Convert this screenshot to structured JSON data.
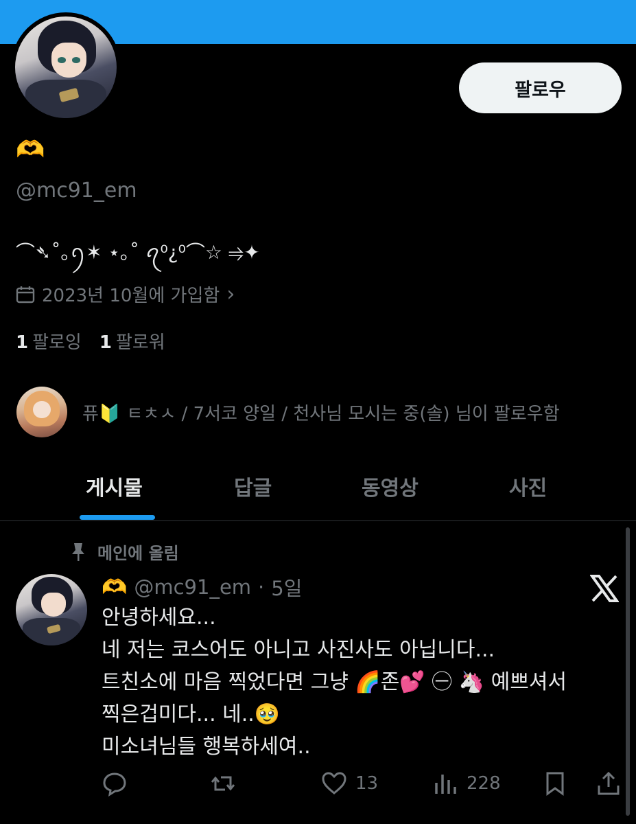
{
  "profile": {
    "display_name": "🫶",
    "handle": "@mc91_em",
    "bio": "⌒➴˚｡ꪆ✶ ⋆｡˚ ꪖ⁰¿⁰⌒☆ ⥤✦",
    "joined": "2023년 10월에 가입함",
    "joined_chevron": "›",
    "following_count": "1",
    "following_label": "팔로잉",
    "followers_count": "1",
    "followers_label": "팔로워",
    "follow_button": "팔로우",
    "followed_by": "퓨🔰 ㅌㅊㅅ / 7서코 양일 / 천사님 모시는 중(솔) 님이 팔로우함"
  },
  "tabs": [
    {
      "label": "게시물",
      "active": true
    },
    {
      "label": "답글",
      "active": false
    },
    {
      "label": "동영상",
      "active": false
    },
    {
      "label": "사진",
      "active": false
    }
  ],
  "pinned_tweet": {
    "pinned_label": "메인에 올림",
    "author_emoji": "🫶",
    "handle": "@mc91_em",
    "separator": "·",
    "time": "5일",
    "lines": [
      "안녕하세요...",
      "네 저는 코스어도 아니고 사진사도 아닙니다...",
      "트친소에 마음 찍었다면 그냥 🌈존💕 ㊀ 🦄 예쁘셔서",
      "찍은겁미다... 네..🥹",
      "미소녀님들 행복하세여.."
    ],
    "likes": "13",
    "views": "228"
  },
  "colors": {
    "banner": "#1d9bf0",
    "accent": "#1d9bf0",
    "muted_text": "#71767b",
    "primary_text": "#e7e9ea"
  },
  "icons": [
    "calendar-icon",
    "pin-icon",
    "x-logo-icon",
    "reply-icon",
    "retweet-icon",
    "like-icon",
    "views-icon",
    "bookmark-icon",
    "share-icon"
  ]
}
